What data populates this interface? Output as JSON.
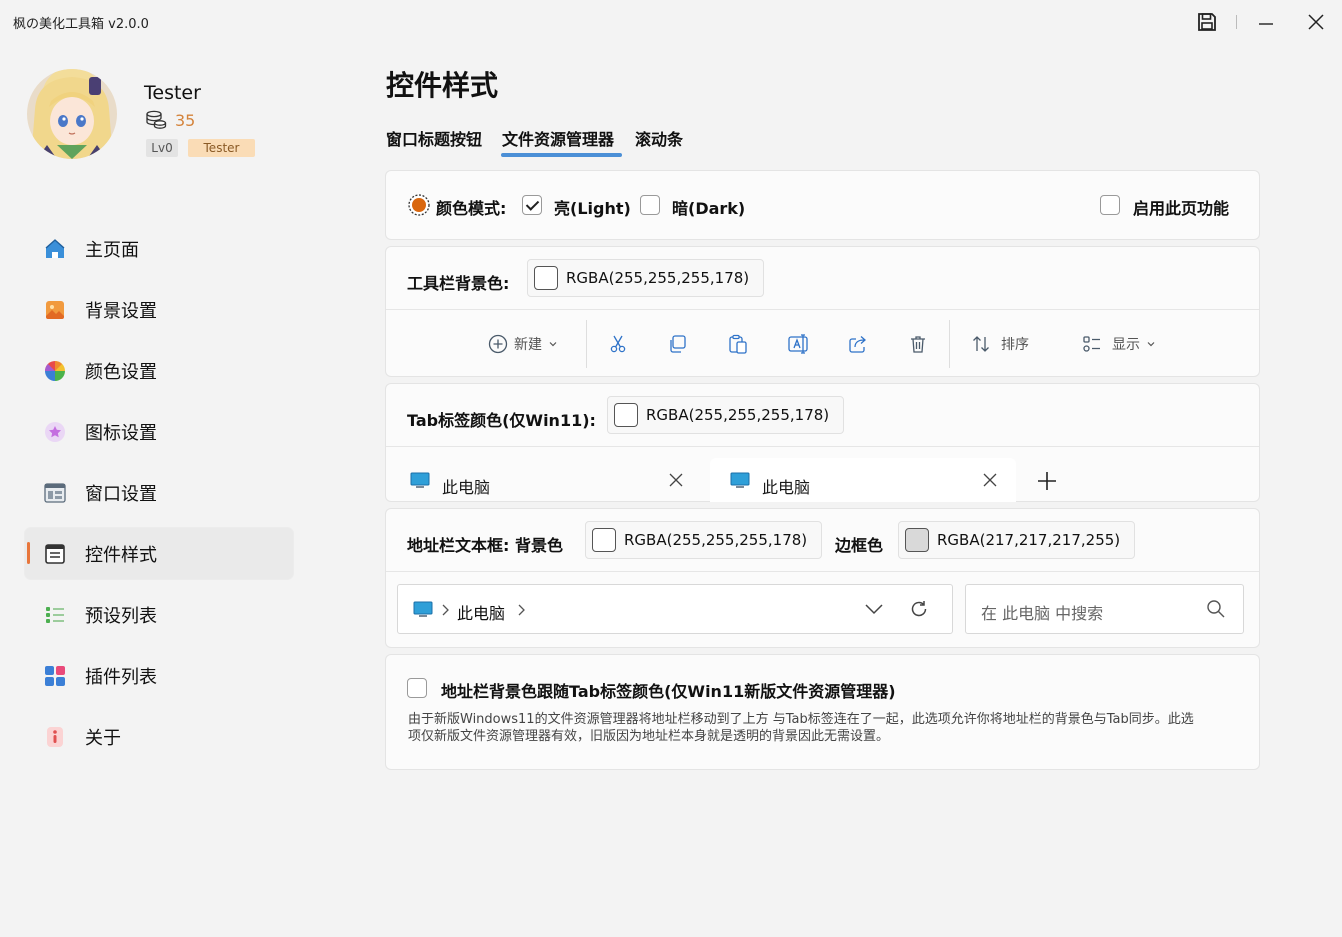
{
  "window": {
    "title": "枫の美化工具箱 v2.0.0"
  },
  "user": {
    "name": "Tester",
    "coins": "35",
    "level": "Lv0",
    "role": "Tester"
  },
  "sidebar": {
    "items": [
      {
        "label": "主页面",
        "icon": "home-icon"
      },
      {
        "label": "背景设置",
        "icon": "picture-icon"
      },
      {
        "label": "颜色设置",
        "icon": "color-wheel-icon"
      },
      {
        "label": "图标设置",
        "icon": "star-icon"
      },
      {
        "label": "窗口设置",
        "icon": "window-icon"
      },
      {
        "label": "控件样式",
        "icon": "controls-icon",
        "active": true
      },
      {
        "label": "预设列表",
        "icon": "list-icon"
      },
      {
        "label": "插件列表",
        "icon": "plugin-icon"
      },
      {
        "label": "关于",
        "icon": "info-icon"
      }
    ]
  },
  "main": {
    "title": "控件样式",
    "tabs": [
      {
        "label": "窗口标题按钮"
      },
      {
        "label": "文件资源管理器",
        "active": true
      },
      {
        "label": "滚动条"
      }
    ],
    "color_mode": {
      "label": "颜色模式:",
      "light_label": "亮(Light)",
      "light_checked": true,
      "dark_label": "暗(Dark)",
      "dark_checked": false,
      "enable_label": "启用此页功能",
      "enable_checked": false
    },
    "toolbar_bg": {
      "label": "工具栏背景色:",
      "value": "RGBA(255,255,255,178)",
      "tools": {
        "new_label": "新建",
        "sort_label": "排序",
        "view_label": "显示"
      }
    },
    "tab_color": {
      "label": "Tab标签颜色(仅Win11):",
      "value": "RGBA(255,255,255,178)",
      "tab_labels": [
        "此电脑",
        "此电脑"
      ]
    },
    "address_bar": {
      "label": "地址栏文本框: 背景色",
      "bg_value": "RGBA(255,255,255,178)",
      "border_label": "边框色",
      "border_value": "RGBA(217,217,217,255)",
      "border_color": "#d9d9d9",
      "path_label": "此电脑",
      "search_placeholder": "在 此电脑 中搜索"
    },
    "follow": {
      "label": "地址栏背景色跟随Tab标签颜色(仅Win11新版文件资源管理器)",
      "checked": false,
      "description": "由于新版Windows11的文件资源管理器将地址栏移动到了上方 与Tab标签连在了一起，此选项允许你将地址栏的背景色与Tab同步。此选项仅新版文件资源管理器有效，旧版因为地址栏本身就是透明的背景因此无需设置。"
    }
  },
  "colors": {
    "accent": "#e8763b",
    "tab_indicator": "#4b8fd6",
    "coin": "#d4843c"
  }
}
